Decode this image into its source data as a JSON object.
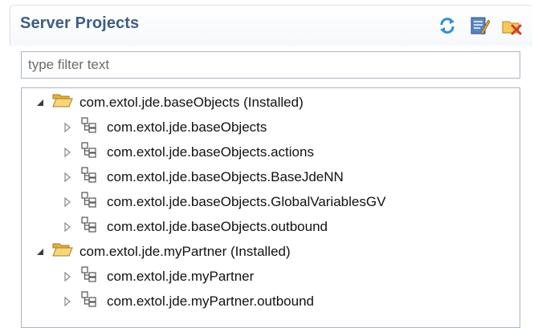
{
  "view": {
    "title": "Server Projects",
    "toolbar": [
      {
        "name": "refresh-button",
        "icon": "refresh-icon"
      },
      {
        "name": "configure-button",
        "icon": "edit-document-icon"
      },
      {
        "name": "uninstall-button",
        "icon": "delete-folder-icon"
      }
    ]
  },
  "filter": {
    "placeholder": "type filter text",
    "value": ""
  },
  "tree": {
    "projects": [
      {
        "label": "com.extol.jde.baseObjects (Installed)",
        "expanded": true,
        "children": [
          "com.extol.jde.baseObjects",
          "com.extol.jde.baseObjects.actions",
          "com.extol.jde.baseObjects.BaseJdeNN",
          "com.extol.jde.baseObjects.GlobalVariablesGV",
          "com.extol.jde.baseObjects.outbound"
        ]
      },
      {
        "label": "com.extol.jde.myPartner (Installed)",
        "expanded": true,
        "children": [
          "com.extol.jde.myPartner",
          "com.extol.jde.myPartner.outbound"
        ]
      }
    ]
  },
  "colors": {
    "title": "#3f5d83",
    "border": "#a9b4c2",
    "folder": "#f3c95a"
  }
}
